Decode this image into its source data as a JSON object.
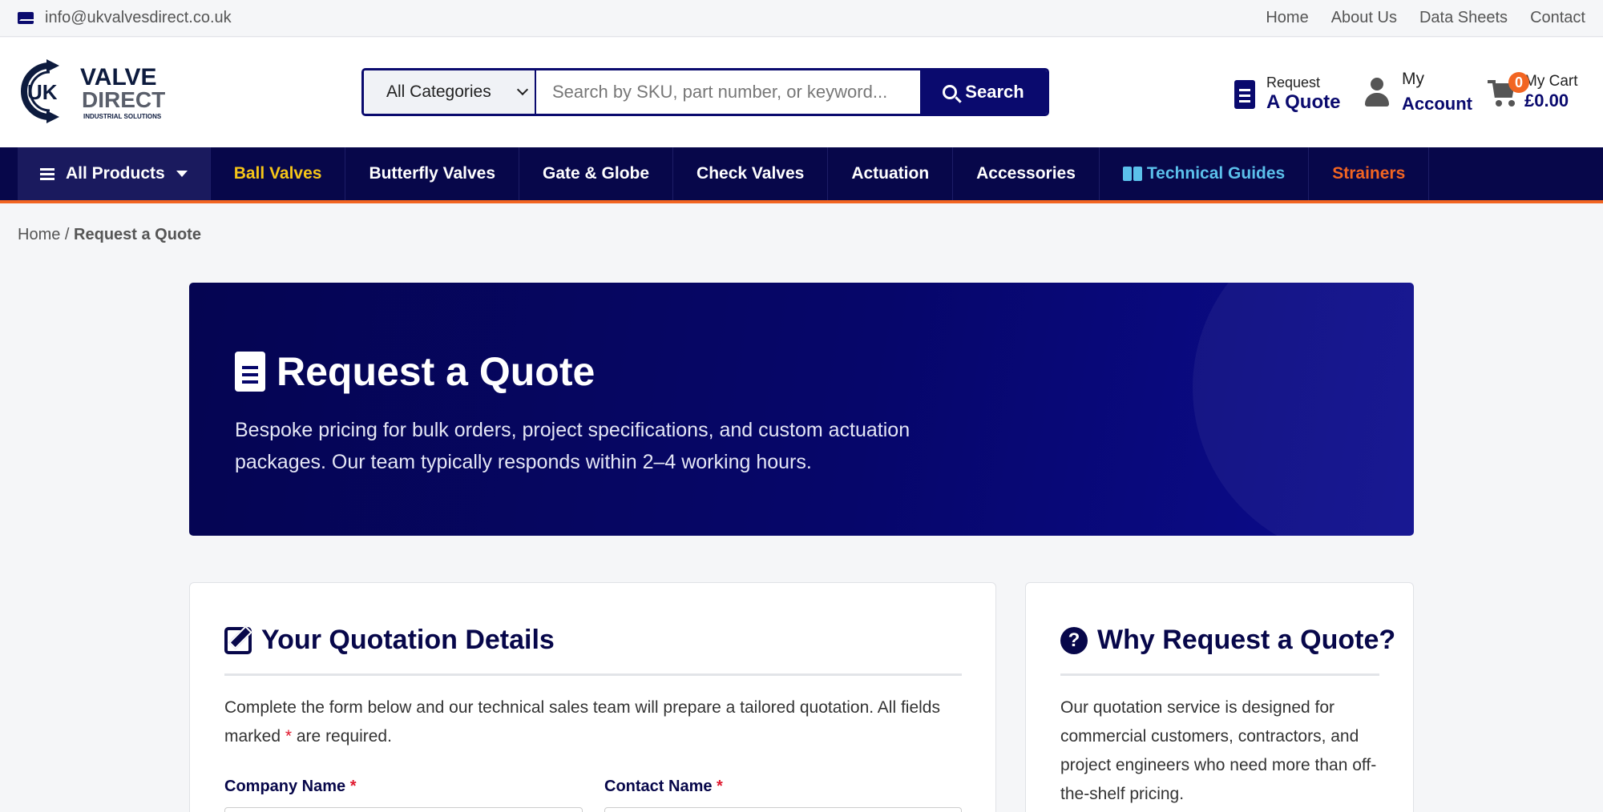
{
  "topbar": {
    "email": "info@ukvalvesdirect.co.uk",
    "links": [
      "Home",
      "About Us",
      "Data Sheets",
      "Contact"
    ]
  },
  "header": {
    "logo": {
      "uk": "UK",
      "line1": "VALVE",
      "line2": "DIRECT",
      "tagline": "INDUSTRIAL SOLUTIONS"
    },
    "search": {
      "category_selected": "All Categories",
      "placeholder": "Search by SKU, part number, or keyword...",
      "button_label": "Search"
    },
    "quote": {
      "small": "Request",
      "big": "A Quote"
    },
    "account": {
      "line1": "My",
      "line2": "Account"
    },
    "cart": {
      "count": "0",
      "label": "My Cart",
      "total": "£0.00"
    }
  },
  "nav": {
    "all_products": "All Products",
    "items": [
      {
        "label": "Ball Valves",
        "color": "#f5c518"
      },
      {
        "label": "Butterfly Valves",
        "color": "#ffffff"
      },
      {
        "label": "Gate & Globe",
        "color": "#ffffff"
      },
      {
        "label": "Check Valves",
        "color": "#ffffff"
      },
      {
        "label": "Actuation",
        "color": "#ffffff"
      },
      {
        "label": "Accessories",
        "color": "#ffffff"
      },
      {
        "label": "Technical Guides",
        "color": "#5bc0eb"
      },
      {
        "label": "Strainers",
        "color": "#f26522"
      }
    ]
  },
  "breadcrumb": {
    "home": "Home",
    "separator": " / ",
    "current": "Request a Quote"
  },
  "hero": {
    "title": "Request a Quote",
    "text": "Bespoke pricing for bulk orders, project specifications, and custom actuation packages. Our team typically responds within 2–4 working hours."
  },
  "quote_form": {
    "title": "Your Quotation Details",
    "intro_before": "Complete the form below and our technical sales team will prepare a tailored quotation. All fields marked ",
    "required_mark": "*",
    "intro_after": " are required.",
    "fields": [
      {
        "label": "Company Name"
      },
      {
        "label": "Contact Name"
      }
    ]
  },
  "why": {
    "title": "Why Request a Quote?",
    "text": "Our quotation service is designed for commercial customers, contractors, and project engineers who need more than off-the-shelf pricing."
  },
  "colors": {
    "brand_navy": "#07074a",
    "accent_orange": "#f26522",
    "accent_yellow": "#f5c518",
    "accent_cyan": "#5bc0eb"
  }
}
